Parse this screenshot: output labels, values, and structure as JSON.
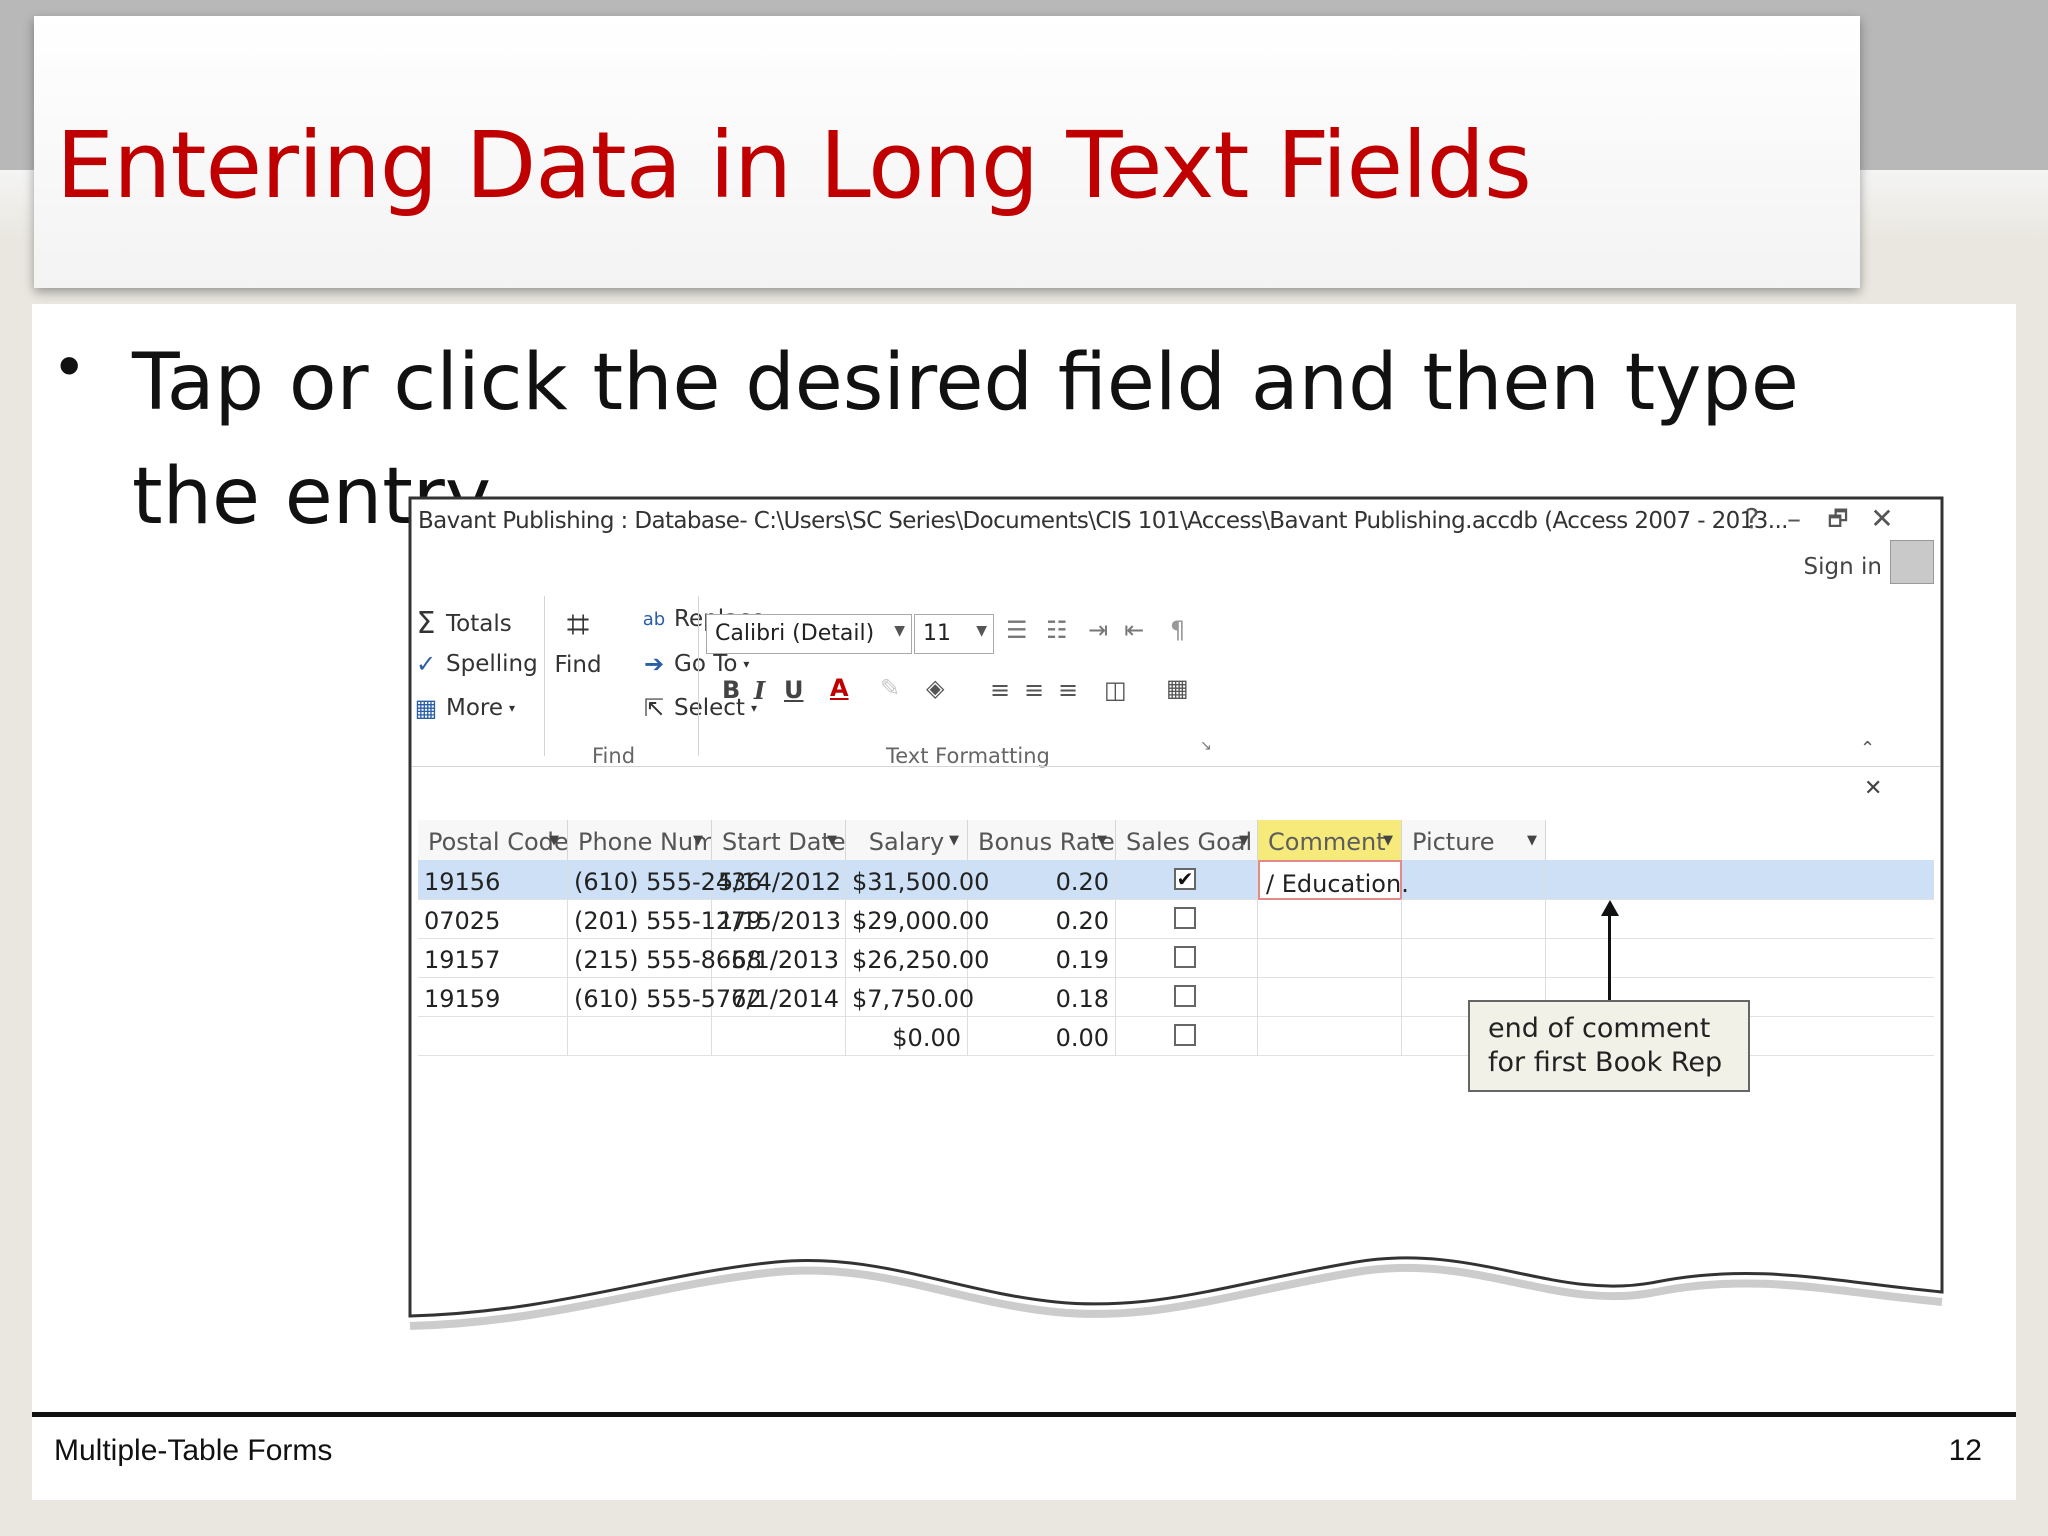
{
  "slide": {
    "title": "Entering Data in Long Text Fields",
    "bullet": "Tap or click the desired field and then type the entry",
    "footer_left": "Multiple-Table Forms",
    "page_number": "12"
  },
  "window": {
    "title": "Bavant Publishing : Database- C:\\Users\\SC Series\\Documents\\CIS 101\\Access\\Bavant Publishing.accdb (Access 2007 - 2013...",
    "help": "?",
    "minimize": "–",
    "restore": "🗗",
    "close": "✕",
    "sign_in": "Sign in"
  },
  "ribbon": {
    "records": {
      "totals": "Totals",
      "spelling": "Spelling",
      "more": "More"
    },
    "find": {
      "find": "Find",
      "replace": "Replace",
      "goto": "Go To",
      "select": "Select",
      "group_label": "Find"
    },
    "text_formatting": {
      "font": "Calibri (Detail)",
      "size": "11",
      "bold": "B",
      "italic": "I",
      "underline": "U",
      "group_label": "Text Formatting"
    }
  },
  "datasheet": {
    "close": "✕",
    "columns": [
      "Postal Code",
      "Phone Numl",
      "Start Date",
      "Salary",
      "Bonus Rate",
      "Sales Goal",
      "Comment",
      "Picture"
    ],
    "rows": [
      {
        "postal": "19156",
        "phone": "(610) 555-2436",
        "start": "5/14/2012",
        "salary": "$31,500.00",
        "bonus": "0.20",
        "goal": true,
        "comment": "/ Education."
      },
      {
        "postal": "07025",
        "phone": "(201) 555-1279",
        "start": "1/15/2013",
        "salary": "$29,000.00",
        "bonus": "0.20",
        "goal": false,
        "comment": ""
      },
      {
        "postal": "19157",
        "phone": "(215) 555-8658",
        "start": "6/1/2013",
        "salary": "$26,250.00",
        "bonus": "0.19",
        "goal": false,
        "comment": ""
      },
      {
        "postal": "19159",
        "phone": "(610) 555-5762",
        "start": "7/1/2014",
        "salary": "$7,750.00",
        "bonus": "0.18",
        "goal": false,
        "comment": ""
      },
      {
        "postal": "",
        "phone": "",
        "start": "",
        "salary": "$0.00",
        "bonus": "0.00",
        "goal": false,
        "comment": ""
      }
    ]
  },
  "callout": {
    "line1": "end of comment",
    "line2": "for first Book Rep"
  }
}
